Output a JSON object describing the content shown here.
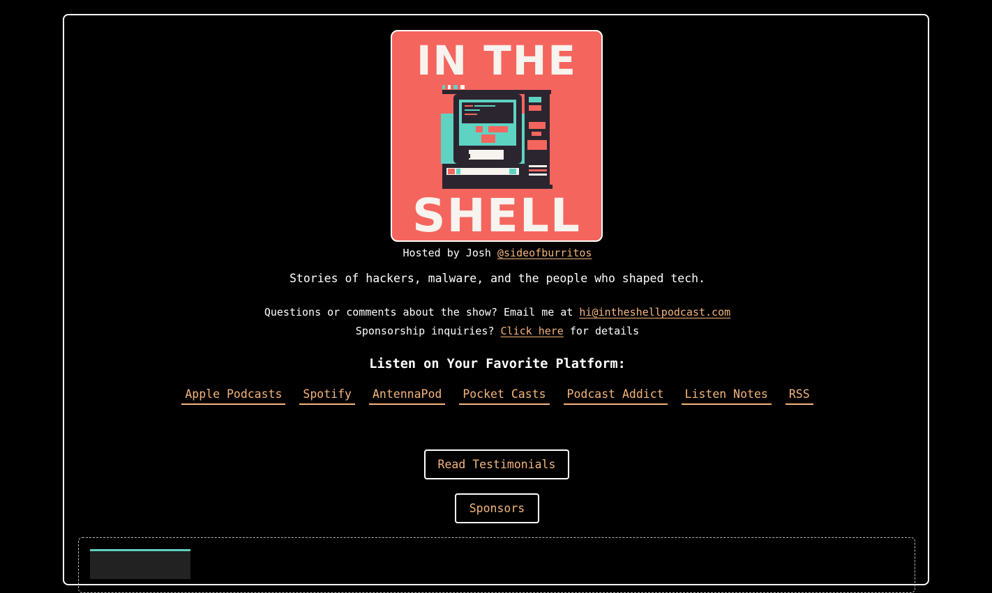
{
  "cover": {
    "title_top": "IN THE",
    "title_bottom": "SHELL",
    "background_color": "#f4655e",
    "accent_color": "#5fd3c2",
    "dark_color": "#2b2530"
  },
  "hosted": {
    "prefix": "Hosted by Josh ",
    "handle": "@sideofburritos"
  },
  "tagline": "Stories of hackers, malware, and the people who shaped tech.",
  "contact": {
    "prefix": "Questions or comments about the show? Email me at ",
    "email": "hi@intheshellpodcast.com"
  },
  "sponsorship": {
    "prefix": "Sponsorship inquiries? ",
    "link": "Click here",
    "suffix": " for details"
  },
  "listen_heading": "Listen on Your Favorite Platform:",
  "platforms": [
    "Apple Podcasts",
    "Spotify",
    "AntennaPod",
    "Pocket Casts",
    "Podcast Addict",
    "Listen Notes",
    "RSS"
  ],
  "buttons": {
    "testimonials": "Read Testimonials",
    "sponsors": "Sponsors"
  },
  "colors": {
    "link": "#f5b57d",
    "background": "#000000",
    "text": "#ffffff"
  }
}
